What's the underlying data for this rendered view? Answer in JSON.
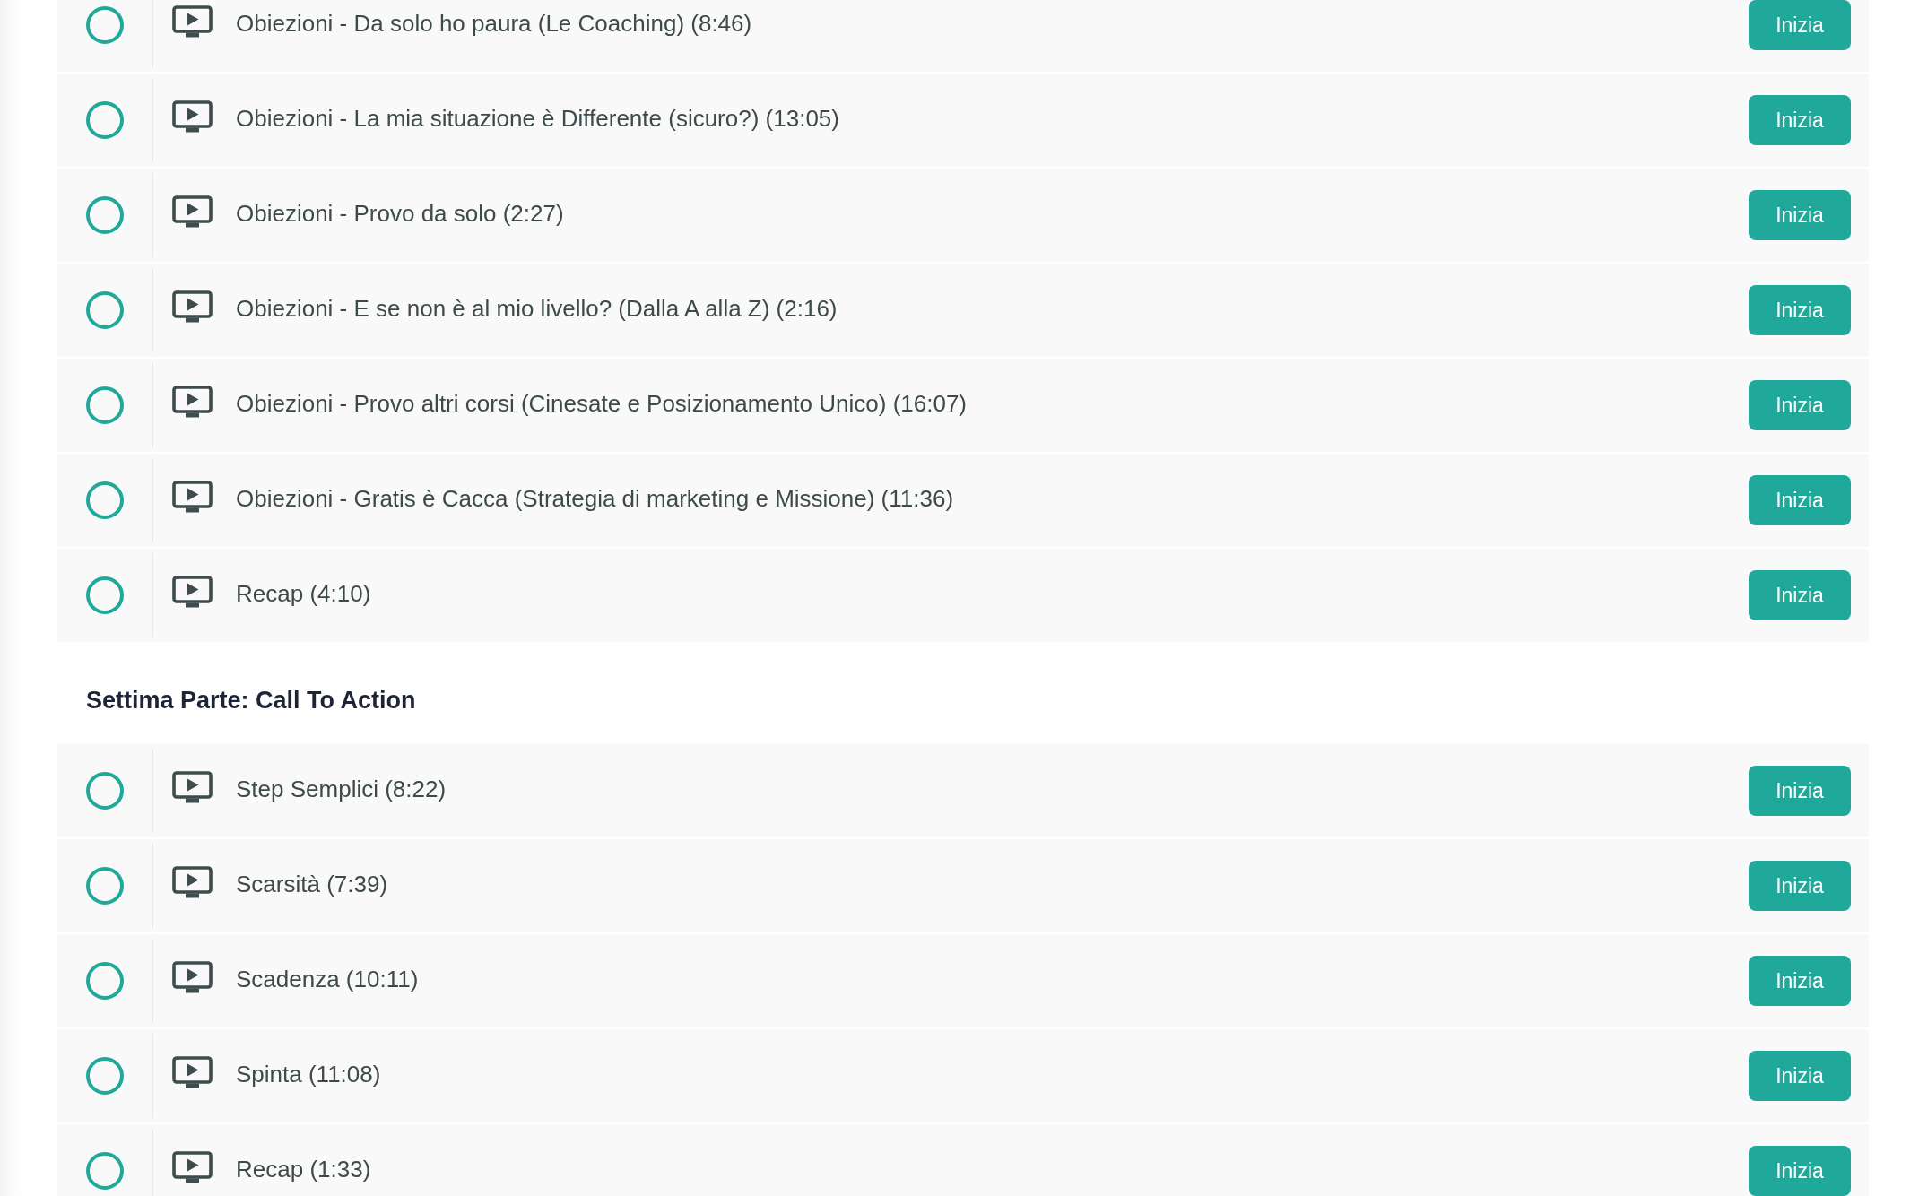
{
  "sections": [
    {
      "lessons": [
        {
          "title": "Obiezioni - Da solo ho paura (Le Coaching) (8:46)",
          "completed": false,
          "button": "Inizia"
        },
        {
          "title": "Obiezioni - La mia situazione è Differente (sicuro?) (13:05)",
          "completed": false,
          "button": "Inizia"
        },
        {
          "title": "Obiezioni - Provo da solo (2:27)",
          "completed": false,
          "button": "Inizia"
        },
        {
          "title": "Obiezioni - E se non è al mio livello? (Dalla A alla Z) (2:16)",
          "completed": false,
          "button": "Inizia"
        },
        {
          "title": "Obiezioni - Provo altri corsi (Cinesate e Posizionamento Unico) (16:07)",
          "completed": false,
          "button": "Inizia"
        },
        {
          "title": "Obiezioni - Gratis è Cacca (Strategia di marketing e Missione) (11:36)",
          "completed": false,
          "button": "Inizia"
        },
        {
          "title": "Recap (4:10)",
          "completed": false,
          "button": "Inizia"
        }
      ]
    },
    {
      "title": "Settima Parte: Call To Action",
      "lessons": [
        {
          "title": "Step Semplici (8:22)",
          "completed": false,
          "button": "Inizia"
        },
        {
          "title": "Scarsità (7:39)",
          "completed": false,
          "button": "Inizia"
        },
        {
          "title": "Scadenza (10:11)",
          "completed": false,
          "button": "Inizia"
        },
        {
          "title": "Spinta (11:08)",
          "completed": false,
          "button": "Inizia"
        },
        {
          "title": "Recap (1:33)",
          "completed": false,
          "button": "Inizia"
        }
      ]
    }
  ]
}
